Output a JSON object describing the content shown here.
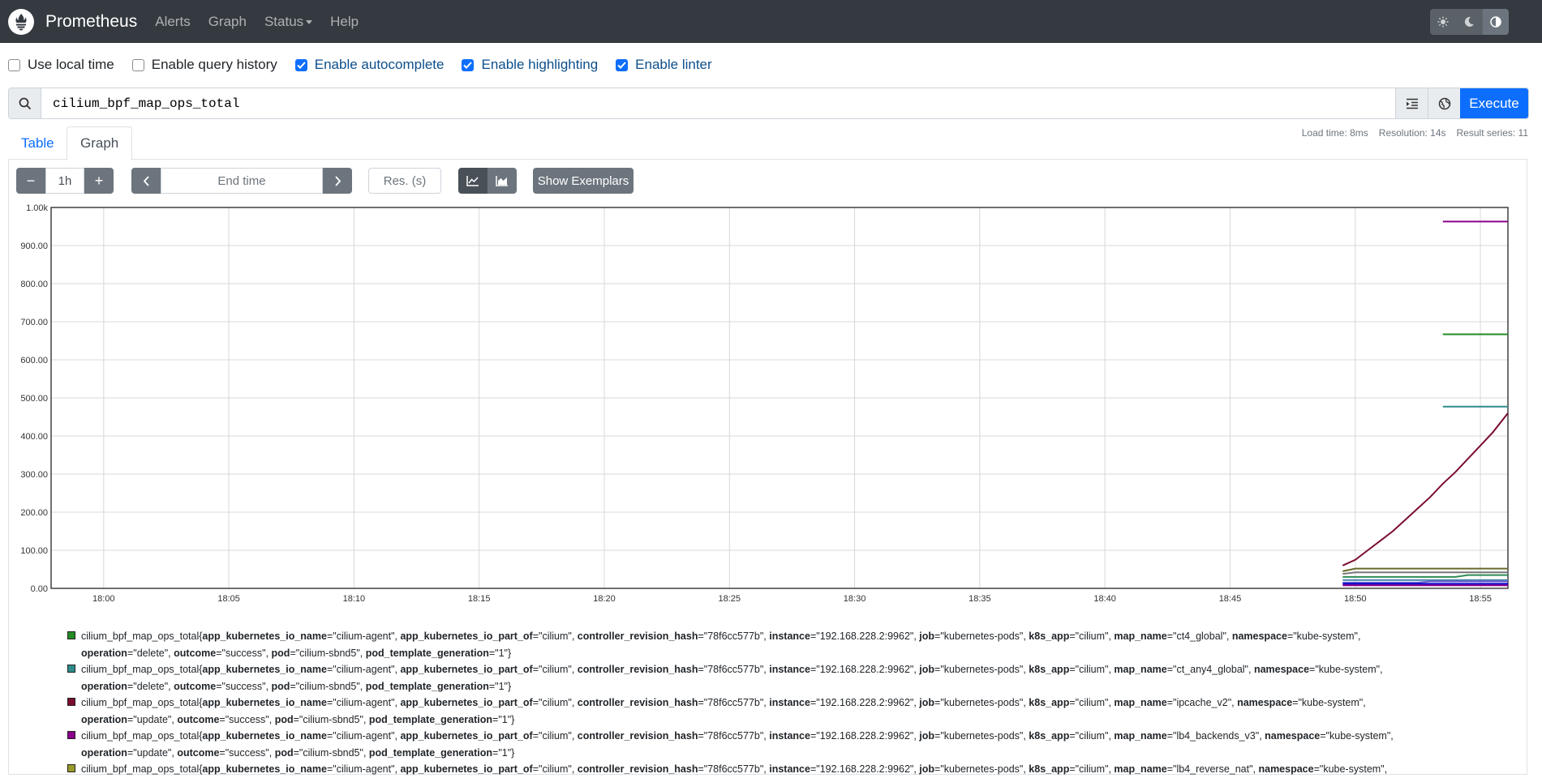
{
  "navbar": {
    "brand": "Prometheus",
    "links": [
      "Alerts",
      "Graph",
      "Status",
      "Help"
    ],
    "theme_icons": [
      "sun-icon",
      "moon-icon",
      "contrast-icon"
    ]
  },
  "options": [
    {
      "label": "Use local time",
      "checked": false
    },
    {
      "label": "Enable query history",
      "checked": false
    },
    {
      "label": "Enable autocomplete",
      "checked": true
    },
    {
      "label": "Enable highlighting",
      "checked": true
    },
    {
      "label": "Enable linter",
      "checked": true
    }
  ],
  "query": {
    "expression": "cilium_bpf_map_ops_total",
    "execute_label": "Execute"
  },
  "stats": {
    "load_time": "Load time: 8ms",
    "resolution": "Resolution: 14s",
    "result_series": "Result series: 11"
  },
  "tabs": {
    "table": "Table",
    "graph": "Graph"
  },
  "controls": {
    "minus": "−",
    "range": "1h",
    "plus": "+",
    "end_time_placeholder": "End time",
    "resolution_placeholder": "Res. (s)",
    "show_exemplars": "Show Exemplars"
  },
  "chart_data": {
    "type": "line",
    "y_ticks": [
      "0.00",
      "100.00",
      "200.00",
      "300.00",
      "400.00",
      "500.00",
      "600.00",
      "700.00",
      "800.00",
      "900.00",
      "1.00k"
    ],
    "x_ticks": [
      "18:00",
      "18:05",
      "18:10",
      "18:15",
      "18:20",
      "18:25",
      "18:30",
      "18:35",
      "18:40",
      "18:45",
      "18:50",
      "18:55"
    ],
    "ylim": [
      0,
      1000
    ],
    "xlim_minutes": [
      57.9,
      116.1
    ],
    "x_tick_minutes": [
      60,
      65,
      70,
      75,
      80,
      85,
      90,
      95,
      100,
      105,
      110,
      115
    ],
    "grid": true,
    "series": [
      {
        "color": "#8b008b",
        "x": [
          113.5,
          116.1
        ],
        "y": [
          963,
          963
        ]
      },
      {
        "color": "#228b22",
        "x": [
          113.5,
          116.1
        ],
        "y": [
          667,
          667
        ]
      },
      {
        "color": "#2e8b8b",
        "x": [
          113.5,
          116.1
        ],
        "y": [
          477,
          477
        ]
      },
      {
        "color": "#7a0d2e",
        "x": [
          109.5,
          110.0,
          110.5,
          111.0,
          111.5,
          112.0,
          112.5,
          113.0,
          113.5,
          114.0,
          114.5,
          115.0,
          115.5,
          116.1
        ],
        "y": [
          60,
          75,
          100,
          125,
          150,
          180,
          210,
          240,
          275,
          305,
          340,
          375,
          410,
          460
        ]
      },
      {
        "color": "#6a6a2a",
        "x": [
          109.5,
          110.0,
          116.1
        ],
        "y": [
          45,
          52,
          52
        ]
      },
      {
        "color": "#777777",
        "x": [
          109.5,
          110.0,
          116.1
        ],
        "y": [
          38,
          42,
          42
        ]
      },
      {
        "color": "#2e8b57",
        "x": [
          109.5,
          114.0,
          114.5,
          116.1
        ],
        "y": [
          30,
          30,
          35,
          35
        ]
      },
      {
        "color": "#4682b4",
        "x": [
          109.5,
          116.1
        ],
        "y": [
          22,
          22
        ]
      },
      {
        "color": "#6a5acd",
        "x": [
          109.5,
          112.5,
          113.0,
          116.1
        ],
        "y": [
          15,
          15,
          18,
          18
        ]
      },
      {
        "color": "#0000cd",
        "x": [
          109.5,
          116.1
        ],
        "y": [
          12,
          12
        ]
      },
      {
        "color": "#8b008b",
        "x": [
          109.5,
          116.1
        ],
        "y": [
          8,
          8
        ]
      }
    ]
  },
  "legend": [
    {
      "color": "#228b22",
      "metric": "cilium_bpf_map_ops_total{",
      "labels": [
        [
          "app_kubernetes_io_name",
          "\"cilium-agent\", "
        ],
        [
          "app_kubernetes_io_part_of",
          "\"cilium\", "
        ],
        [
          "controller_revision_hash",
          "\"78f6cc577b\", "
        ],
        [
          "instance",
          "\"192.168.228.2:9962\", "
        ],
        [
          "job",
          "\"kubernetes-pods\", "
        ],
        [
          "k8s_app",
          "\"cilium\", "
        ],
        [
          "map_name",
          "\"ct4_global\", "
        ],
        [
          "namespace",
          "\"kube-system\", "
        ],
        [
          "operation",
          "\"delete\", "
        ],
        [
          "outcome",
          "\"success\", "
        ],
        [
          "pod",
          "\"cilium-sbnd5\", "
        ],
        [
          "pod_template_generation",
          "\"1\"}"
        ]
      ]
    },
    {
      "color": "#2e8b8b",
      "metric": "cilium_bpf_map_ops_total{",
      "labels": [
        [
          "app_kubernetes_io_name",
          "\"cilium-agent\", "
        ],
        [
          "app_kubernetes_io_part_of",
          "\"cilium\", "
        ],
        [
          "controller_revision_hash",
          "\"78f6cc577b\", "
        ],
        [
          "instance",
          "\"192.168.228.2:9962\", "
        ],
        [
          "job",
          "\"kubernetes-pods\", "
        ],
        [
          "k8s_app",
          "\"cilium\", "
        ],
        [
          "map_name",
          "\"ct_any4_global\", "
        ],
        [
          "namespace",
          "\"kube-system\", "
        ],
        [
          "operation",
          "\"delete\", "
        ],
        [
          "outcome",
          "\"success\", "
        ],
        [
          "pod",
          "\"cilium-sbnd5\", "
        ],
        [
          "pod_template_generation",
          "\"1\"}"
        ]
      ]
    },
    {
      "color": "#7a0d2e",
      "metric": "cilium_bpf_map_ops_total{",
      "labels": [
        [
          "app_kubernetes_io_name",
          "\"cilium-agent\", "
        ],
        [
          "app_kubernetes_io_part_of",
          "\"cilium\", "
        ],
        [
          "controller_revision_hash",
          "\"78f6cc577b\", "
        ],
        [
          "instance",
          "\"192.168.228.2:9962\", "
        ],
        [
          "job",
          "\"kubernetes-pods\", "
        ],
        [
          "k8s_app",
          "\"cilium\", "
        ],
        [
          "map_name",
          "\"ipcache_v2\", "
        ],
        [
          "namespace",
          "\"kube-system\", "
        ],
        [
          "operation",
          "\"update\", "
        ],
        [
          "outcome",
          "\"success\", "
        ],
        [
          "pod",
          "\"cilium-sbnd5\", "
        ],
        [
          "pod_template_generation",
          "\"1\"}"
        ]
      ]
    },
    {
      "color": "#8b008b",
      "metric": "cilium_bpf_map_ops_total{",
      "labels": [
        [
          "app_kubernetes_io_name",
          "\"cilium-agent\", "
        ],
        [
          "app_kubernetes_io_part_of",
          "\"cilium\", "
        ],
        [
          "controller_revision_hash",
          "\"78f6cc577b\", "
        ],
        [
          "instance",
          "\"192.168.228.2:9962\", "
        ],
        [
          "job",
          "\"kubernetes-pods\", "
        ],
        [
          "k8s_app",
          "\"cilium\", "
        ],
        [
          "map_name",
          "\"lb4_backends_v3\", "
        ],
        [
          "namespace",
          "\"kube-system\", "
        ],
        [
          "operation",
          "\"update\", "
        ],
        [
          "outcome",
          "\"success\", "
        ],
        [
          "pod",
          "\"cilium-sbnd5\", "
        ],
        [
          "pod_template_generation",
          "\"1\"}"
        ]
      ]
    },
    {
      "color": "#9a9a2a",
      "metric": "cilium_bpf_map_ops_total{",
      "labels": [
        [
          "app_kubernetes_io_name",
          "\"cilium-agent\", "
        ],
        [
          "app_kubernetes_io_part_of",
          "\"cilium\", "
        ],
        [
          "controller_revision_hash",
          "\"78f6cc577b\", "
        ],
        [
          "instance",
          "\"192.168.228.2:9962\", "
        ],
        [
          "job",
          "\"kubernetes-pods\", "
        ],
        [
          "k8s_app",
          "\"cilium\", "
        ],
        [
          "map_name",
          "\"lb4_reverse_nat\", "
        ],
        [
          "namespace",
          "\"kube-system\", "
        ]
      ]
    }
  ]
}
